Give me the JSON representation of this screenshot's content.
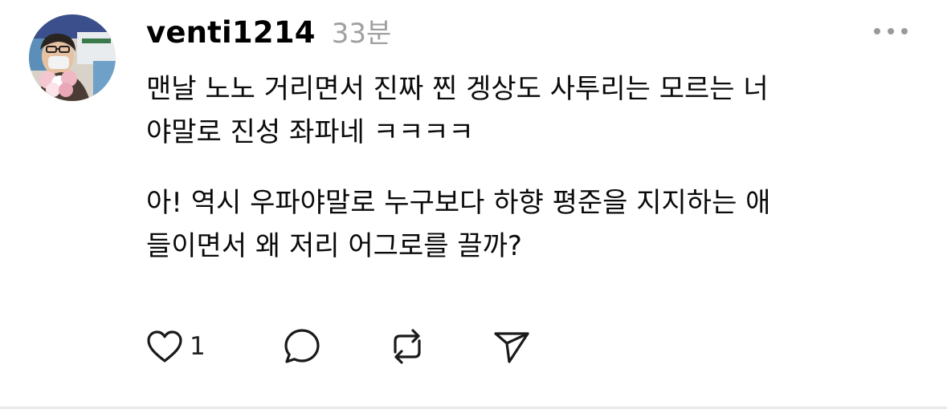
{
  "post": {
    "author": "venti1214",
    "timestamp": "33분",
    "paragraphs": [
      {
        "lines": [
          "맨날 노노 거리면서 진짜 찐 겡상도 사투리는 모르는 너",
          "야말로 진성 좌파네 ㅋㅋㅋㅋ"
        ]
      },
      {
        "lines": [
          "아! 역시 우파야말로 누구보다 하향 평준을 지지하는 애",
          "들이면서 왜 저리 어그로를 끌까?"
        ]
      }
    ],
    "like_count": "1"
  },
  "icons": {
    "more": "more-options-icon",
    "like": "heart-icon",
    "reply": "comment-bubble-icon",
    "repost": "repost-icon",
    "share": "send-icon"
  },
  "colors": {
    "text": "#000000",
    "muted": "#a0a0a0",
    "icon": "#1a1a1a",
    "divider": "#e9e9e9"
  }
}
